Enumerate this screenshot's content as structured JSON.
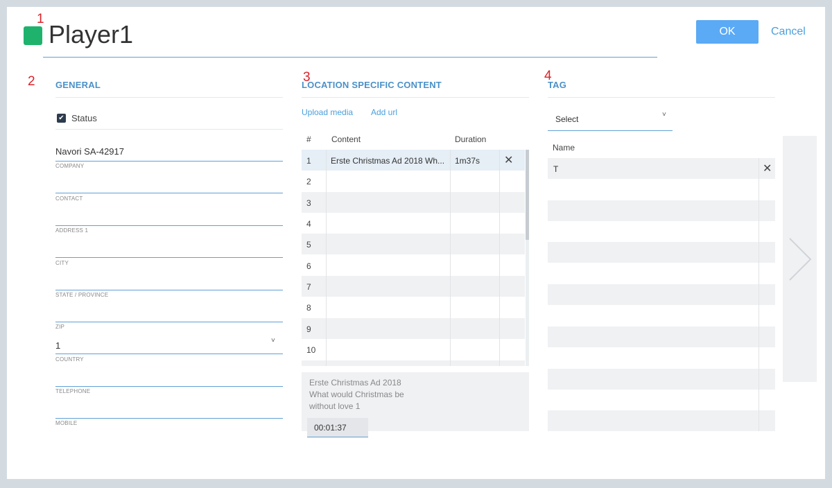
{
  "annotations": [
    "1",
    "2",
    "3",
    "4"
  ],
  "header": {
    "title": "Player1",
    "ok_label": "OK",
    "cancel_label": "Cancel",
    "status_color": "#1fb26d",
    "accent_color": "#5aaaf6"
  },
  "general": {
    "heading": "GENERAL",
    "status_label": "Status",
    "status_checked": true,
    "fields": [
      {
        "label": "COMPANY",
        "value": "Navori SA-42917"
      },
      {
        "label": "CONTACT",
        "value": ""
      },
      {
        "label": "ADDRESS 1",
        "value": ""
      },
      {
        "label": "CITY",
        "value": ""
      },
      {
        "label": "STATE / PROVINCE",
        "value": ""
      },
      {
        "label": "ZIP",
        "value": ""
      },
      {
        "label": "COUNTRY",
        "value": "1"
      },
      {
        "label": "TELEPHONE",
        "value": ""
      },
      {
        "label": "MOBILE",
        "value": ""
      }
    ]
  },
  "content": {
    "heading": "LOCATION SPECIFIC CONTENT",
    "upload_label": "Upload media",
    "add_url_label": "Add url",
    "columns": [
      "#",
      "Content",
      "Duration"
    ],
    "rows": [
      {
        "num": "1",
        "content": "Erste Christmas Ad 2018 Wh...",
        "duration": "1m37s",
        "removable": true
      },
      {
        "num": "2",
        "content": "",
        "duration": ""
      },
      {
        "num": "3",
        "content": "",
        "duration": ""
      },
      {
        "num": "4",
        "content": "",
        "duration": ""
      },
      {
        "num": "5",
        "content": "",
        "duration": ""
      },
      {
        "num": "6",
        "content": "",
        "duration": ""
      },
      {
        "num": "7",
        "content": "",
        "duration": ""
      },
      {
        "num": "8",
        "content": "",
        "duration": ""
      },
      {
        "num": "9",
        "content": "",
        "duration": ""
      },
      {
        "num": "10",
        "content": "",
        "duration": ""
      }
    ],
    "remove_icon": "close-icon",
    "detail_text": "Erste Christmas Ad 2018 What would Christmas be without love 1",
    "detail_time": "00:01:37"
  },
  "tag": {
    "heading": "TAG",
    "select_value": "Select",
    "name_column": "Name",
    "rows": [
      "T",
      "",
      "",
      "",
      "",
      "",
      "",
      "",
      "",
      "",
      "",
      "",
      ""
    ]
  }
}
